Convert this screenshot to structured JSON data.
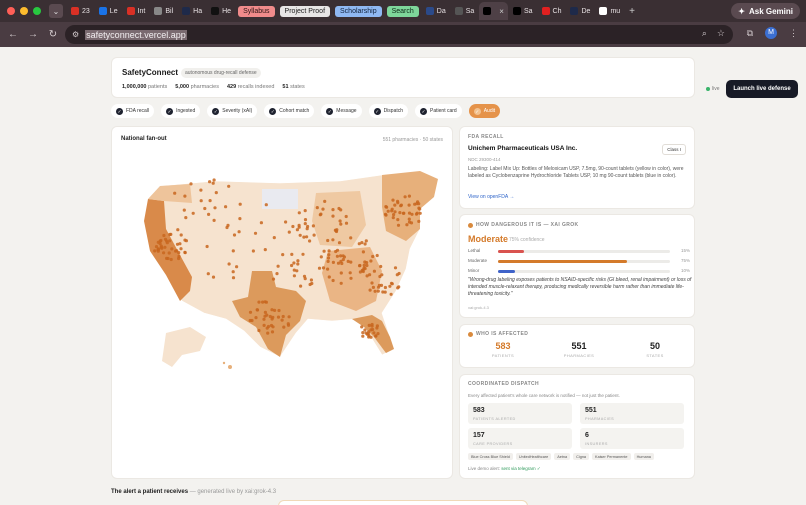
{
  "browser": {
    "tabs": [
      {
        "label": "23",
        "icon": "gmail-icon",
        "color": "#d93025"
      },
      {
        "label": "Le",
        "icon": "link-icon",
        "color": "#1a73e8"
      },
      {
        "label": "Int",
        "icon": "gmail-icon",
        "color": "#d93025"
      },
      {
        "label": "Bil",
        "icon": "puzzle-icon",
        "color": "#888888"
      },
      {
        "label": "Ha",
        "icon": "d-icon",
        "color": "#1e2a4a"
      },
      {
        "label": "He",
        "icon": "plus-icon",
        "color": "#111111"
      }
    ],
    "pill_tabs": [
      {
        "label": "Syllabus",
        "bg": "#f08b8b",
        "color": "#2a1414"
      },
      {
        "label": "Project Proof",
        "bg": "#e8e6e6",
        "color": "#222222"
      },
      {
        "label": "Scholarship",
        "bg": "#8fb8f2",
        "color": "#10203a"
      },
      {
        "label": "Search",
        "bg": "#7ed69a",
        "color": "#0e2a18"
      }
    ],
    "tabs2": [
      {
        "label": "Da",
        "icon": "db-icon",
        "color": "#2b4a8a"
      },
      {
        "label": "Sa",
        "icon": "globe-icon",
        "color": "#555555"
      },
      {
        "label": "",
        "icon": "triangle-icon",
        "color": "#000000",
        "active": true
      },
      {
        "label": "Sa",
        "icon": "triangle-icon",
        "color": "#000000"
      },
      {
        "label": "Ch",
        "icon": "youtube-icon",
        "color": "#e02020"
      },
      {
        "label": "De",
        "icon": "d-icon",
        "color": "#1e2a4a"
      },
      {
        "label": "mu",
        "icon": "github-icon",
        "color": "#ffffff"
      }
    ],
    "ask_gemini": "Ask Gemini",
    "url": "safetyconnect.vercel.app",
    "avatar_letter": "M"
  },
  "header": {
    "brand": "SafetyConnect",
    "badge": "autonomous drug-recall defense",
    "stats": [
      {
        "value": "1,000,000",
        "label": "patients"
      },
      {
        "value": "5,000",
        "label": "pharmacies"
      },
      {
        "value": "429",
        "label": "recalls indexed"
      },
      {
        "value": "51",
        "label": "states"
      }
    ],
    "live_label": "live",
    "launch_button": "Launch live defense"
  },
  "steps": [
    {
      "label": "FDA recall",
      "active": false
    },
    {
      "label": "Ingested",
      "active": false
    },
    {
      "label": "Severity (xAI)",
      "active": false
    },
    {
      "label": "Cohort match",
      "active": false
    },
    {
      "label": "Message",
      "active": false
    },
    {
      "label": "Dispatch",
      "active": false
    },
    {
      "label": "Patient card",
      "active": false
    },
    {
      "label": "Audit",
      "active": true
    }
  ],
  "map": {
    "title": "National fan-out",
    "meta": "551 pharmacies · 50 states"
  },
  "fda": {
    "label": "FDA RECALL",
    "firm": "Unichem Pharmaceuticals USA Inc.",
    "class": "Class I",
    "ndc": "NDC 29300-414",
    "labeling": "Labeling: Label Mix Up: Bottles of Meloxicam USP, 7.5mg, 90-count tablets (yellow in color), were labeled as Cyclobenzaprine Hydrochloride Tablets USP, 10 mg 90-count tablets (blue in color).",
    "link": "View on openFDA →"
  },
  "danger": {
    "label": "HOW DANGEROUS IT IS — XAI GROK",
    "level": "Moderate",
    "confidence": "75% confidence",
    "rows": [
      {
        "label": "Lethal",
        "value": 15,
        "pct": "15%",
        "color": "#d9534f"
      },
      {
        "label": "Moderate",
        "value": 75,
        "pct": "75%",
        "color": "#d47a2a"
      },
      {
        "label": "Minor",
        "value": 10,
        "pct": "10%",
        "color": "#3f63c9"
      }
    ],
    "quote": "\"Wrong-drug labeling exposes patients to NSAID-specific risks (GI bleed, renal impairment) or loss of intended muscle-relaxant therapy, producing medically reversible harm rather than immediate life-threatening toxicity.\"",
    "model": "xai:grok-4.3"
  },
  "affected": {
    "label": "WHO IS AFFECTED",
    "items": [
      {
        "value": "583",
        "label": "PATIENTS",
        "color": "#d47a2a"
      },
      {
        "value": "551",
        "label": "PHARMACIES",
        "color": "#222222"
      },
      {
        "value": "50",
        "label": "STATES",
        "color": "#222222"
      }
    ]
  },
  "dispatch": {
    "label": "COORDINATED DISPATCH",
    "subtitle": "Every affected patient's whole care network is notified — not just the patient.",
    "boxes": [
      {
        "value": "583",
        "label": "PATIENTS ALERTED"
      },
      {
        "value": "551",
        "label": "PHARMACIES"
      },
      {
        "value": "157",
        "label": "CARE PROVIDERS"
      },
      {
        "value": "6",
        "label": "INSURERS"
      }
    ],
    "insurers": [
      "Blue Cross Blue Shield",
      "UnitedHealthcare",
      "Aetna",
      "Cigna",
      "Kaiser Permanente",
      "Humana"
    ],
    "live_demo_prefix": "Live demo alert:",
    "live_demo_status": "sent via telegram ✓"
  },
  "alert": {
    "title": "The alert a patient receives",
    "subtitle": "— generated live by xai:grok-4.3"
  },
  "colors": {
    "accent": "#d47a2a",
    "dark_button": "#171a26"
  }
}
